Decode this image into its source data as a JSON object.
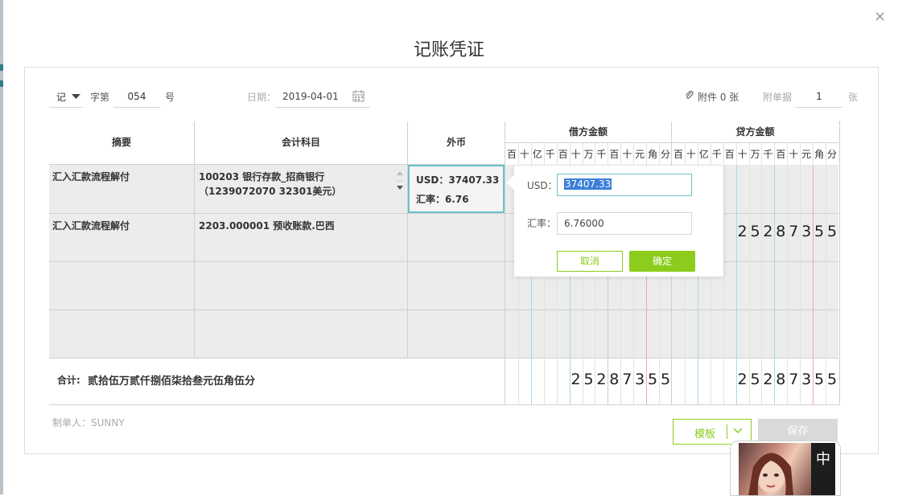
{
  "dialog": {
    "title": "记账凭证",
    "close_glyph": "×"
  },
  "header": {
    "voucher_word": "记",
    "zi_label": "字第",
    "voucher_no": "054",
    "hao_label": "号",
    "date_label": "日期：",
    "date_value": "2019-04-01",
    "attachment_label": "附件 0 张",
    "attach_doc_label": "附单据",
    "attach_doc_count": "1",
    "zhang_label": "张"
  },
  "table": {
    "col_summary": "摘要",
    "col_account": "会计科目",
    "col_currency": "外币",
    "col_debit": "借方金额",
    "col_credit": "贷方金额",
    "digit_units": [
      "百",
      "十",
      "亿",
      "千",
      "百",
      "十",
      "万",
      "千",
      "百",
      "十",
      "元",
      "角",
      "分"
    ],
    "rows": [
      {
        "summary": "汇入汇款流程解付",
        "account": "100203 银行存款_招商银行（1239072070 32301美元）",
        "currency_line1": "USD：37407.33",
        "currency_line2": "汇率：6.76",
        "debit": "",
        "credit": ""
      },
      {
        "summary": "汇入汇款流程解付",
        "account": "2203.000001 预收账款.巴西",
        "currency_line1": "",
        "currency_line2": "",
        "debit": "",
        "credit": "25287355"
      },
      {
        "summary": "",
        "account": "",
        "currency_line1": "",
        "currency_line2": "",
        "debit": "",
        "credit": ""
      },
      {
        "summary": "",
        "account": "",
        "currency_line1": "",
        "currency_line2": "",
        "debit": "",
        "credit": ""
      }
    ],
    "total_label": "合计:",
    "total_words": "贰拾伍万贰仟捌佰柒拾叁元伍角伍分",
    "total_debit": "25287355",
    "total_credit": "25287355"
  },
  "popup": {
    "usd_label": "USD：",
    "usd_value": "37407.33",
    "rate_label": "汇率：",
    "rate_value": "6.76000",
    "cancel_label": "取消",
    "confirm_label": "确定"
  },
  "footer": {
    "maker": "制单人：SUNNY",
    "template_label": "模板",
    "save_label": "保存"
  },
  "ad": {
    "text": "中"
  },
  "colors": {
    "accent_green": "#8ccc1c",
    "grid_line": "#d9d9d9",
    "blue_divider": "#a9d6ec",
    "red_divider": "#f0a8a8",
    "focus_teal": "#6cc2c8"
  }
}
